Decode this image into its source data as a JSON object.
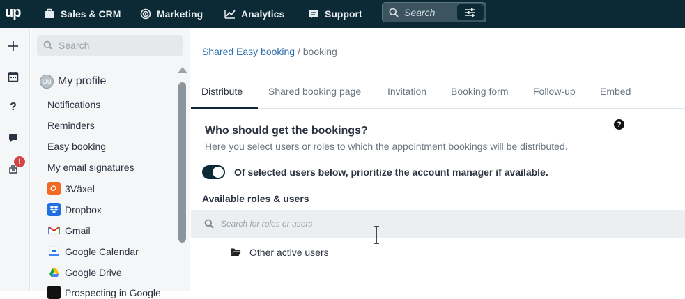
{
  "topbar": {
    "logo": "up",
    "nav": [
      {
        "label": "Sales & CRM",
        "icon": "briefcase-icon"
      },
      {
        "label": "Marketing",
        "icon": "target-icon"
      },
      {
        "label": "Analytics",
        "icon": "chart-line-icon"
      },
      {
        "label": "Support",
        "icon": "chat-icon"
      }
    ],
    "search_placeholder": "Search"
  },
  "leftbar": {
    "icons": [
      "plus-icon",
      "calendar-icon",
      "question-icon",
      "chat-bubble-icon",
      "lab-icon"
    ],
    "badge": "!"
  },
  "sidebar": {
    "search_placeholder": "Search",
    "profile": {
      "avatar": "Uu",
      "label": "My profile"
    },
    "items": [
      {
        "label": "Notifications"
      },
      {
        "label": "Reminders"
      },
      {
        "label": "Easy booking"
      },
      {
        "label": "My email signatures"
      },
      {
        "label": "3Växel",
        "icon": "3vaxel-icon",
        "color": "#f26a21"
      },
      {
        "label": "Dropbox",
        "icon": "dropbox-icon",
        "color": "#1f6fe5"
      },
      {
        "label": "Gmail",
        "icon": "gmail-icon",
        "color": "#d93025"
      },
      {
        "label": "Google Calendar",
        "icon": "google-calendar-icon",
        "color": "#4285f4"
      },
      {
        "label": "Google Drive",
        "icon": "google-drive-icon",
        "color": "#0f9d58"
      },
      {
        "label": "Prospecting in Google"
      }
    ]
  },
  "main": {
    "breadcrumb": {
      "link": "Shared Easy booking",
      "sep": " / ",
      "current": "booking"
    },
    "tabs": [
      "Distribute",
      "Shared booking page",
      "Invitation",
      "Booking form",
      "Follow-up",
      "Embed"
    ],
    "section_title": "Who should get the bookings?",
    "section_desc": "Here you select users or roles to which the appointment bookings will be distributed.",
    "help": "?",
    "toggle_label": "Of selected users below, prioritize the account manager if available.",
    "toggle_on": true,
    "available_title": "Available roles & users",
    "role_search_placeholder": "Search for roles or users",
    "group_label": "Other active users"
  },
  "colors": {
    "topbar": "#0b2a36",
    "link": "#2f6fb0",
    "badge": "#d64545"
  }
}
